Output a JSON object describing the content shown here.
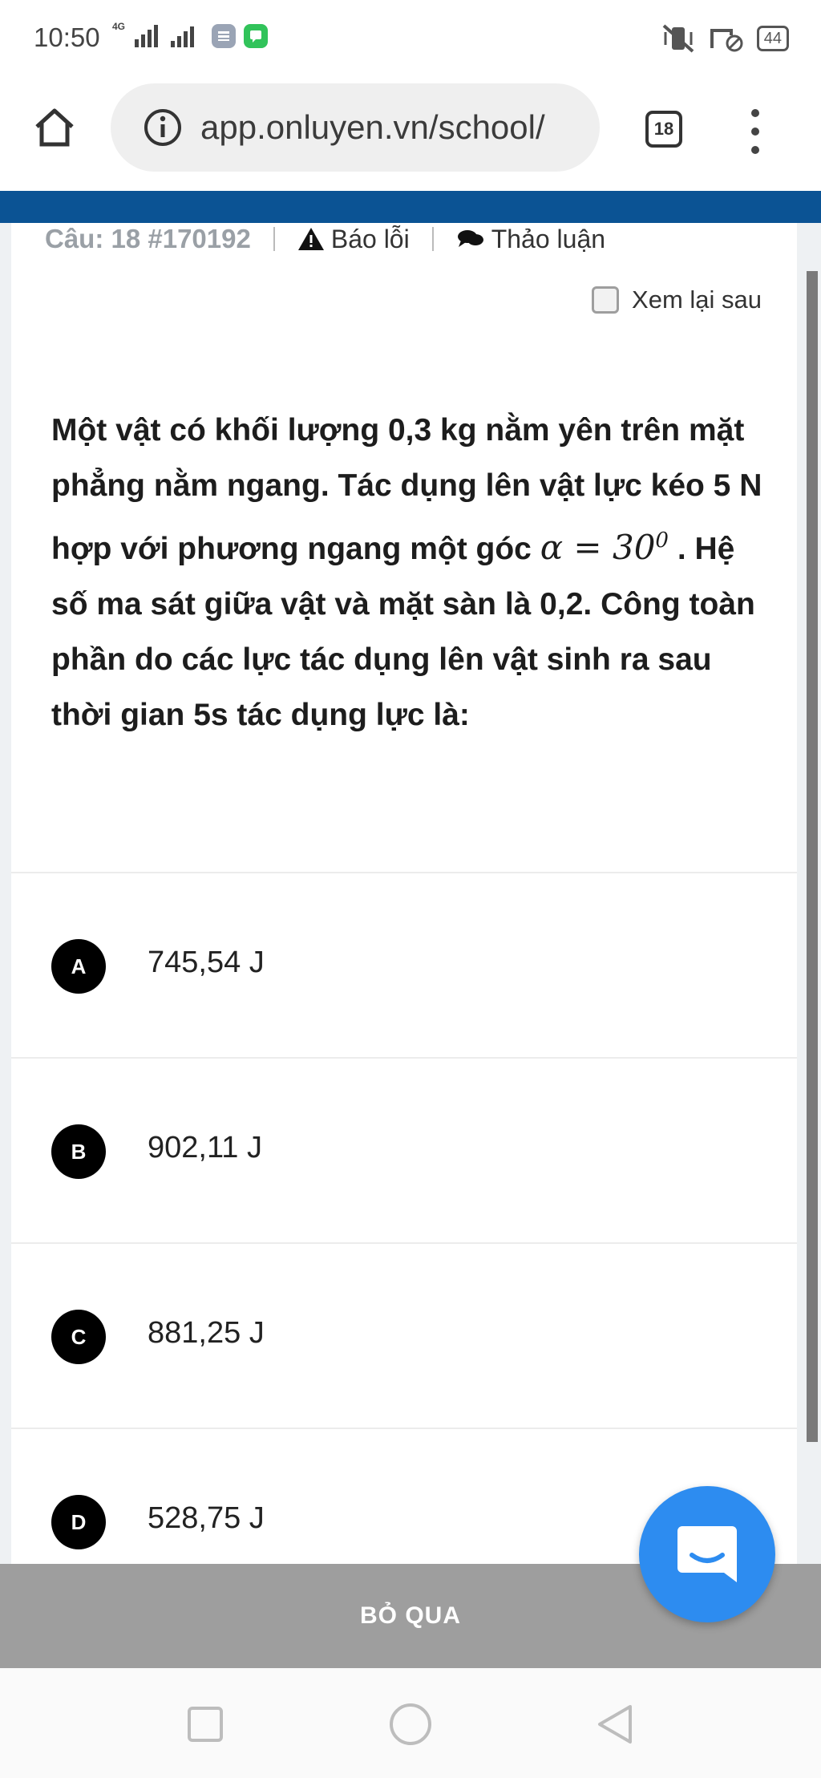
{
  "status_bar": {
    "time": "10:50",
    "network_label": "4G",
    "battery": "44"
  },
  "browser": {
    "url": "app.onluyen.vn/school/",
    "tab_count": "18"
  },
  "question": {
    "number_label": "Câu: 18 #170192",
    "report_label": "Báo lỗi",
    "discuss_label": "Thảo luận",
    "review_later_label": "Xem lại sau",
    "text_part1": "Một vật có khối lượng 0,3 kg nằm yên trên mặt phẳng nằm ngang. Tác dụng lên vật lực kéo 5 N hợp với phương ngang một góc",
    "math_alpha": "α = 30",
    "math_exponent": "0",
    "text_part2": ". Hệ số ma sát giữa vật và mặt sàn là 0,2. Công toàn phần do các lực tác dụng lên vật sinh ra sau thời gian 5s tác dụng lực là:"
  },
  "answers": [
    {
      "letter": "A",
      "text": "745,54 J"
    },
    {
      "letter": "B",
      "text": "902,11 J"
    },
    {
      "letter": "C",
      "text": "881,25 J"
    },
    {
      "letter": "D",
      "text": "528,75 J"
    }
  ],
  "skip_label": "BỎ QUA",
  "colors": {
    "header_blue": "#0b5394",
    "fab_blue": "#2d8cf0",
    "skip_gray": "#9e9e9e"
  }
}
